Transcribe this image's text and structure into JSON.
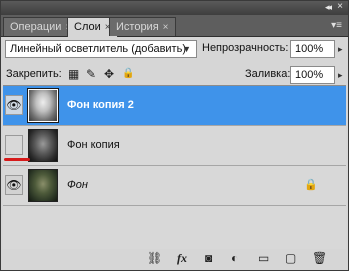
{
  "panel": {
    "tabs": [
      {
        "label": "Операции",
        "close": "×"
      },
      {
        "label": "Слои",
        "close": "×"
      },
      {
        "label": "История",
        "close": "×"
      }
    ],
    "active_tab": 1
  },
  "options": {
    "blend_mode": "Линейный осветлитель (добавить)",
    "opacity_label": "Непрозрачность:",
    "opacity_value": "100%",
    "lock_label": "Закрепить:",
    "fill_label": "Заливка:",
    "fill_value": "100%"
  },
  "layers": [
    {
      "name": "Фон копия 2",
      "visible": true,
      "selected": true
    },
    {
      "name": "Фон копия",
      "visible": false,
      "selected": false
    },
    {
      "name": "Фон",
      "visible": true,
      "selected": false,
      "locked": true
    }
  ],
  "icons": {
    "collapse": "◂◂",
    "close": "×",
    "panel_menu": "▾≡",
    "dropdown_arrow": "▼",
    "spin_arrow": "▸",
    "eye": "👁",
    "lock_transparent": "▦",
    "lock_brush": "✎",
    "lock_move": "✥",
    "lock_all": "🔒",
    "layer_lock": "🔒",
    "link": "⛓",
    "fx": "fx",
    "mask": "◙",
    "adjust": "◐",
    "group": "▭",
    "new_layer": "▢",
    "trash": "🗑"
  },
  "colors": {
    "selected_row": "#3f93ea",
    "panel_bg": "#d6d6d6",
    "tab_bar": "#5e5e5e",
    "annotation_red": "#d61a1a"
  }
}
